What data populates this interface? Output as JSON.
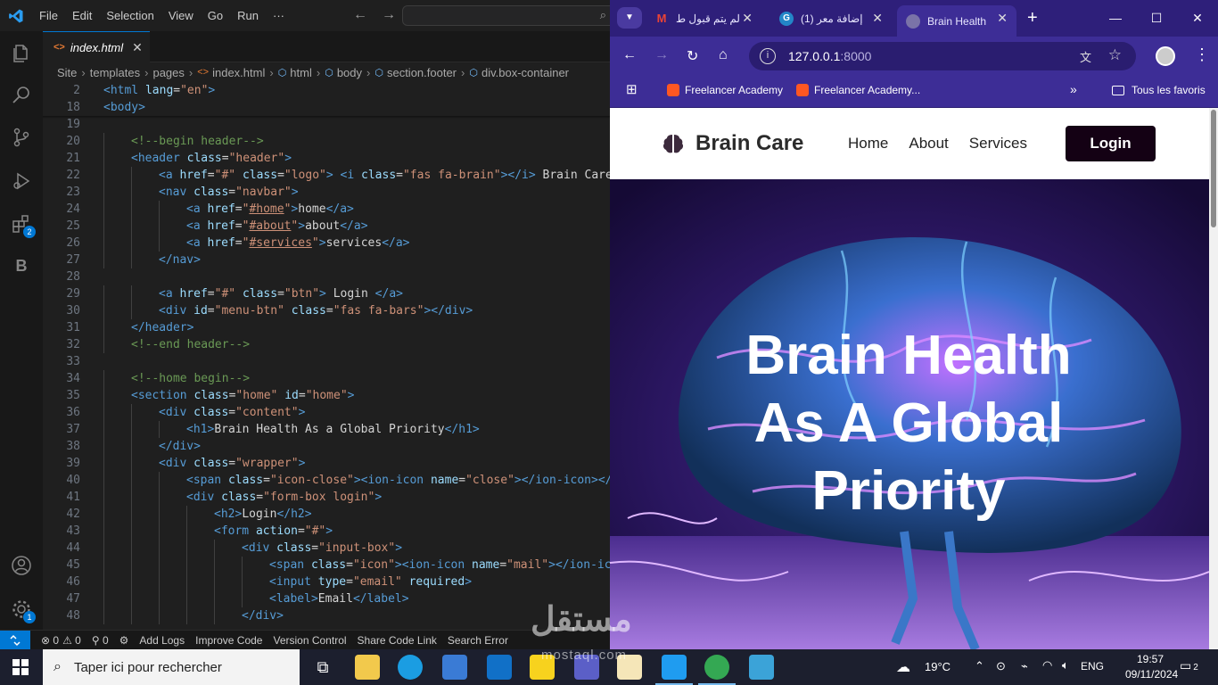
{
  "vscode": {
    "menu": [
      "File",
      "Edit",
      "Selection",
      "View",
      "Go",
      "Run",
      "···"
    ],
    "tab": {
      "icon": "<>",
      "label": "index.html",
      "close": "✕"
    },
    "breadcrumb": [
      "Site",
      "templates",
      "pages",
      "index.html",
      "html",
      "body",
      "section.footer",
      "div.box-container"
    ],
    "activity_badges": {
      "extensions": "2",
      "manage": "1"
    },
    "status": {
      "errors": "⊗ 0",
      "warnings": "⚠ 0",
      "ports": "⚲ 0",
      "items": [
        "Add Logs",
        "Improve Code",
        "Version Control",
        "Share Code Link",
        "Search Error"
      ]
    },
    "sticky_lines": [
      {
        "n": "2",
        "html": "<span class=\"tag\">&lt;html</span> <span class=\"attr\">lang</span>=<span class=\"str\">\"en\"</span><span class=\"tag\">&gt;</span>"
      },
      {
        "n": "18",
        "html": "<span class=\"tag\">&lt;body&gt;</span>"
      }
    ],
    "lines": [
      {
        "n": "19",
        "indent": 0,
        "html": ""
      },
      {
        "n": "20",
        "indent": 1,
        "html": "<span class=\"cmt\">&lt;!--begin header--&gt;</span>"
      },
      {
        "n": "21",
        "indent": 1,
        "html": "<span class=\"tag\">&lt;header</span> <span class=\"attr\">class</span>=<span class=\"str\">\"header\"</span><span class=\"tag\">&gt;</span>"
      },
      {
        "n": "22",
        "indent": 2,
        "html": "<span class=\"tag\">&lt;a</span> <span class=\"attr\">href</span>=<span class=\"str\">\"#\"</span> <span class=\"attr\">class</span>=<span class=\"str\">\"logo\"</span><span class=\"tag\">&gt;</span> <span class=\"tag\">&lt;i</span> <span class=\"attr\">class</span>=<span class=\"str\">\"fas fa-brain\"</span><span class=\"tag\">&gt;&lt;/i&gt;</span> Brain Care<span class=\"tag\">&lt;/a&gt;</span>"
      },
      {
        "n": "23",
        "indent": 2,
        "html": "<span class=\"tag\">&lt;nav</span> <span class=\"attr\">class</span>=<span class=\"str\">\"navbar\"</span><span class=\"tag\">&gt;</span>"
      },
      {
        "n": "24",
        "indent": 3,
        "html": "<span class=\"tag\">&lt;a</span> <span class=\"attr\">href</span>=<span class=\"str\">\"<span class=\"lnk\">#home</span>\"</span><span class=\"tag\">&gt;</span>home<span class=\"tag\">&lt;/a&gt;</span>"
      },
      {
        "n": "25",
        "indent": 3,
        "html": "<span class=\"tag\">&lt;a</span> <span class=\"attr\">href</span>=<span class=\"str\">\"<span class=\"lnk\">#about</span>\"</span><span class=\"tag\">&gt;</span>about<span class=\"tag\">&lt;/a&gt;</span>"
      },
      {
        "n": "26",
        "indent": 3,
        "html": "<span class=\"tag\">&lt;a</span> <span class=\"attr\">href</span>=<span class=\"str\">\"<span class=\"lnk\">#services</span>\"</span><span class=\"tag\">&gt;</span>services<span class=\"tag\">&lt;/a&gt;</span>"
      },
      {
        "n": "27",
        "indent": 2,
        "html": "<span class=\"tag\">&lt;/nav&gt;</span>"
      },
      {
        "n": "28",
        "indent": 0,
        "html": ""
      },
      {
        "n": "29",
        "indent": 2,
        "html": "<span class=\"tag\">&lt;a</span> <span class=\"attr\">href</span>=<span class=\"str\">\"#\"</span> <span class=\"attr\">class</span>=<span class=\"str\">\"btn\"</span><span class=\"tag\">&gt;</span> Login <span class=\"tag\">&lt;/a&gt;</span>"
      },
      {
        "n": "30",
        "indent": 2,
        "html": "<span class=\"tag\">&lt;div</span> <span class=\"attr\">id</span>=<span class=\"str\">\"menu-btn\"</span> <span class=\"attr\">class</span>=<span class=\"str\">\"fas fa-bars\"</span><span class=\"tag\">&gt;&lt;/div&gt;</span>"
      },
      {
        "n": "31",
        "indent": 1,
        "html": "<span class=\"tag\">&lt;/header&gt;</span>"
      },
      {
        "n": "32",
        "indent": 1,
        "html": "<span class=\"cmt\">&lt;!--end header--&gt;</span>"
      },
      {
        "n": "33",
        "indent": 0,
        "html": ""
      },
      {
        "n": "34",
        "indent": 1,
        "html": "<span class=\"cmt\">&lt;!--home begin--&gt;</span>"
      },
      {
        "n": "35",
        "indent": 1,
        "html": "<span class=\"tag\">&lt;section</span> <span class=\"attr\">class</span>=<span class=\"str\">\"home\"</span> <span class=\"attr\">id</span>=<span class=\"str\">\"home\"</span><span class=\"tag\">&gt;</span>"
      },
      {
        "n": "36",
        "indent": 2,
        "html": "<span class=\"tag\">&lt;div</span> <span class=\"attr\">class</span>=<span class=\"str\">\"content\"</span><span class=\"tag\">&gt;</span>"
      },
      {
        "n": "37",
        "indent": 3,
        "html": "<span class=\"tag\">&lt;h1&gt;</span>Brain Health As a Global Priority<span class=\"tag\">&lt;/h1&gt;</span>"
      },
      {
        "n": "38",
        "indent": 2,
        "html": "<span class=\"tag\">&lt;/div&gt;</span>"
      },
      {
        "n": "39",
        "indent": 2,
        "html": "<span class=\"tag\">&lt;div</span> <span class=\"attr\">class</span>=<span class=\"str\">\"wrapper\"</span><span class=\"tag\">&gt;</span>"
      },
      {
        "n": "40",
        "indent": 3,
        "html": "<span class=\"tag\">&lt;span</span> <span class=\"attr\">class</span>=<span class=\"str\">\"icon-close\"</span><span class=\"tag\">&gt;&lt;ion-icon</span> <span class=\"attr\">name</span>=<span class=\"str\">\"close\"</span><span class=\"tag\">&gt;&lt;/ion-icon&gt;&lt;/s</span>"
      },
      {
        "n": "41",
        "indent": 3,
        "html": "<span class=\"tag\">&lt;div</span> <span class=\"attr\">class</span>=<span class=\"str\">\"form-box login\"</span><span class=\"tag\">&gt;</span>"
      },
      {
        "n": "42",
        "indent": 4,
        "html": "<span class=\"tag\">&lt;h2&gt;</span>Login<span class=\"tag\">&lt;/h2&gt;</span>"
      },
      {
        "n": "43",
        "indent": 4,
        "html": "<span class=\"tag\">&lt;form</span> <span class=\"attr\">action</span>=<span class=\"str\">\"#\"</span><span class=\"tag\">&gt;</span>"
      },
      {
        "n": "44",
        "indent": 5,
        "html": "<span class=\"tag\">&lt;div</span> <span class=\"attr\">class</span>=<span class=\"str\">\"input-box\"</span><span class=\"tag\">&gt;</span>"
      },
      {
        "n": "45",
        "indent": 6,
        "html": "<span class=\"tag\">&lt;span</span> <span class=\"attr\">class</span>=<span class=\"str\">\"icon\"</span><span class=\"tag\">&gt;&lt;ion-icon</span> <span class=\"attr\">name</span>=<span class=\"str\">\"mail\"</span><span class=\"tag\">&gt;&lt;/ion-ico</span>"
      },
      {
        "n": "46",
        "indent": 6,
        "html": "<span class=\"tag\">&lt;input</span> <span class=\"attr\">type</span>=<span class=\"str\">\"email\"</span> <span class=\"attr\">required</span><span class=\"tag\">&gt;</span>"
      },
      {
        "n": "47",
        "indent": 6,
        "html": "<span class=\"tag\">&lt;label&gt;</span>Email<span class=\"tag\">&lt;/label&gt;</span>"
      },
      {
        "n": "48",
        "indent": 5,
        "html": "<span class=\"tag\">&lt;/div&gt;</span>"
      }
    ]
  },
  "chrome": {
    "tabs": [
      {
        "title": "لم يتم قبول ط",
        "icon": "gmail-icon",
        "color": "#ea4335",
        "fav": "M"
      },
      {
        "title": "(1) إضافة معر",
        "icon": "mostaql-icon",
        "color": "#2386c8",
        "fav": "G"
      },
      {
        "title": "Brain Health",
        "icon": "globe-icon",
        "color": "#7a73a8",
        "fav": ""
      }
    ],
    "url_host": "127.0.0.1",
    "url_port": ":8000",
    "bookmarks": [
      "Freelancer Academy",
      "Freelancer Academy..."
    ],
    "all_bookmarks": "Tous les favoris",
    "accent": "#3d2d96"
  },
  "site": {
    "logo": "Brain Care",
    "nav": [
      "Home",
      "About",
      "Services"
    ],
    "login": "Login",
    "hero_title_lines": [
      "Brain Health",
      "As A Global",
      "Priority"
    ]
  },
  "watermark": {
    "arabic": "مستقل",
    "latin": "mostaql.com"
  },
  "taskbar": {
    "search_placeholder": "Taper ici pour rechercher",
    "weather": "19°C",
    "lang": "ENG",
    "time": "19:57",
    "date": "09/11/2024",
    "notifications": "2"
  }
}
